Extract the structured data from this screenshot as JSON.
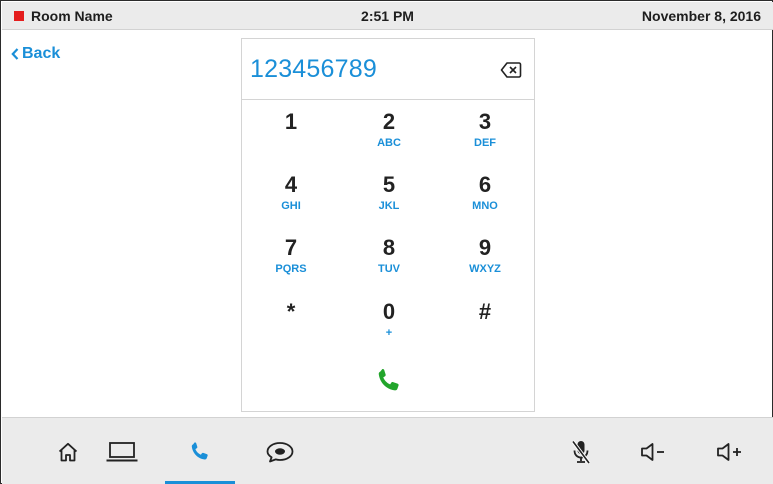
{
  "status_bar": {
    "room_name": "Room Name",
    "time": "2:51 PM",
    "date": "November 8, 2016",
    "status_color": "#e41d1d"
  },
  "back_label": "Back",
  "dialer": {
    "number": "123456789",
    "keys": [
      {
        "digit": "1",
        "letters": ""
      },
      {
        "digit": "2",
        "letters": "ABC"
      },
      {
        "digit": "3",
        "letters": "DEF"
      },
      {
        "digit": "4",
        "letters": "GHI"
      },
      {
        "digit": "5",
        "letters": "JKL"
      },
      {
        "digit": "6",
        "letters": "MNO"
      },
      {
        "digit": "7",
        "letters": "PQRS"
      },
      {
        "digit": "8",
        "letters": "TUV"
      },
      {
        "digit": "9",
        "letters": "WXYZ"
      },
      {
        "digit": "*",
        "letters": ""
      },
      {
        "digit": "0",
        "letters": "+"
      },
      {
        "digit": "#",
        "letters": ""
      }
    ],
    "call_color": "#22a52b"
  },
  "nav": {
    "items": [
      {
        "icon": "home-icon"
      },
      {
        "icon": "laptop-icon"
      },
      {
        "icon": "phone-icon",
        "active": true
      },
      {
        "icon": "chat-bubble-icon"
      },
      {
        "icon": "mic-muted-icon"
      },
      {
        "icon": "volume-down-icon"
      },
      {
        "icon": "volume-up-icon"
      }
    ]
  },
  "colors": {
    "accent": "#1a8fd8",
    "bar_bg": "#ebebeb",
    "text": "#222222"
  }
}
